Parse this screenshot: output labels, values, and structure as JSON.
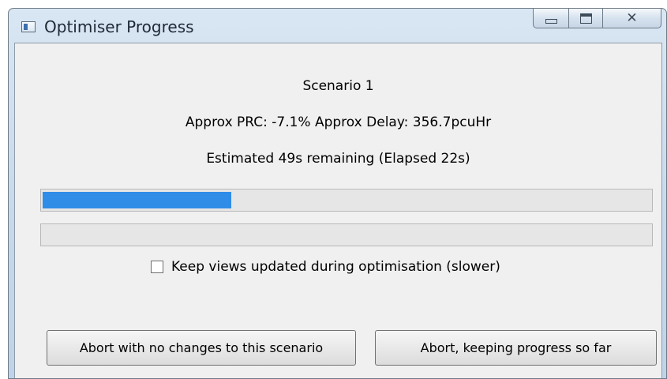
{
  "window": {
    "title": "Optimiser Progress",
    "controls": [
      "minimize",
      "maximize",
      "close"
    ]
  },
  "status": {
    "scenario": "Scenario 1",
    "metrics": "Approx PRC: -7.1%  Approx Delay: 356.7pcuHr",
    "time": "Estimated 49s remaining (Elapsed 22s)"
  },
  "progress": {
    "overall_percent": 31,
    "secondary_percent": 0,
    "fill_color": "#2f8de8"
  },
  "options": {
    "keep_views_label": "Keep views updated during optimisation (slower)",
    "keep_views_checked": false
  },
  "buttons": {
    "abort_no_changes": "Abort with no changes to this scenario",
    "abort_keep_progress": "Abort, keeping progress so far"
  }
}
